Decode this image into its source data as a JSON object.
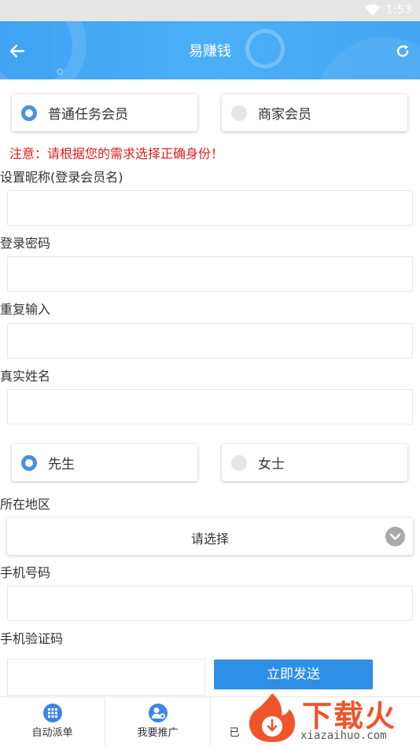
{
  "status_bar": {
    "time": "1:53",
    "wifi_icon": "wifi-icon"
  },
  "header": {
    "title": "易赚钱",
    "back_icon": "back-arrow-icon",
    "refresh_icon": "refresh-icon"
  },
  "member_type": {
    "options": [
      {
        "label": "普通任务会员",
        "selected": true
      },
      {
        "label": "商家会员",
        "selected": false
      }
    ]
  },
  "notice": "注意：请根据您的需求选择正确身份！",
  "fields": {
    "nickname_label": "设置昵称(登录会员名)",
    "password_label": "登录密码",
    "repeat_label": "重复输入",
    "realname_label": "真实姓名",
    "region_label": "所在地区",
    "phone_label": "手机号码",
    "code_label": "手机验证码"
  },
  "gender": {
    "options": [
      {
        "label": "先生",
        "selected": true
      },
      {
        "label": "女士",
        "selected": false
      }
    ]
  },
  "region_select": {
    "value": "请选择"
  },
  "send_button": "立即发送",
  "tabbar": {
    "items": [
      {
        "label": "自动派单",
        "icon": "grid-icon"
      },
      {
        "label": "我要推广",
        "icon": "add-user-icon"
      },
      {
        "label": "已",
        "icon": ""
      }
    ]
  },
  "watermark": {
    "cn": "下载火",
    "en": "xiazaihuo.com"
  },
  "colors": {
    "accent": "#4a90e2",
    "header": "#43a5f4",
    "notice": "#e01c1c",
    "button": "#2d8fe6"
  }
}
